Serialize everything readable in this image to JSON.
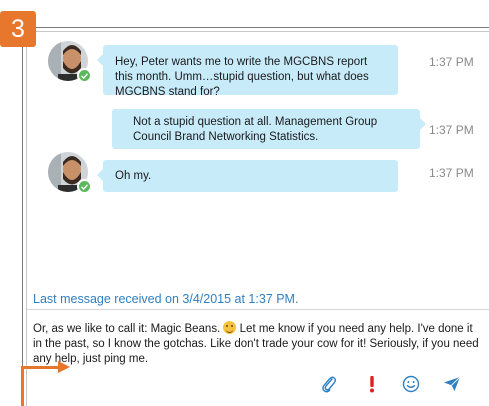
{
  "step_badge": "3",
  "messages": [
    {
      "direction": "in",
      "text": "Hey, Peter wants me to write the MGCBNS report this month. Umm…stupid question, but what does MGCBNS stand for?",
      "time": "1:37 PM"
    },
    {
      "direction": "out",
      "text": "Not a stupid question at all. Management Group Council Brand Networking Statistics.",
      "time": "1:37 PM"
    },
    {
      "direction": "in",
      "text": "Oh my.",
      "time": "1:37 PM"
    }
  ],
  "last_message_status": "Last message received on 3/4/2015 at 1:37 PM.",
  "compose": {
    "text_before_emoji": "Or, as we like to call it: Magic Beans. ",
    "text_after_emoji": " Let me know if you need any help. I've done it in the past, so I know the gotchas. Like don't trade your cow for it! Seriously, if you need any help, just ping me."
  },
  "toolbar": {
    "icons": [
      "paperclip-icon",
      "exclamation-icon",
      "smiley-icon",
      "send-icon"
    ]
  },
  "colors": {
    "bubble": "#c8ebfa",
    "accent_orange": "#e8772e",
    "status_blue": "#2f7fc1",
    "presence_green": "#5cb85c",
    "important_red": "#e02020"
  }
}
